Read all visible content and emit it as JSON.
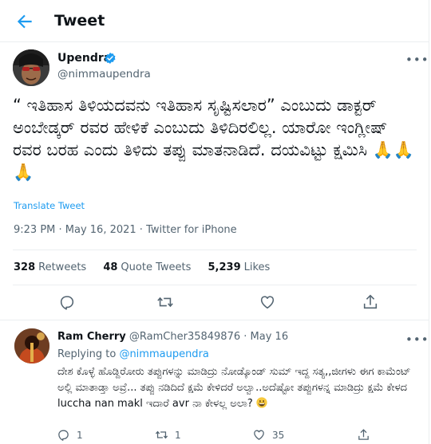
{
  "header": {
    "title": "Tweet"
  },
  "tweet": {
    "author_name": "Upendra",
    "author_handle": "@nimmaupendra",
    "text": "“ ಇತಿಹಾಸ ತಿಳಿಯದವನು ಇತಿಹಾಸ ಸೃಷ್ಟಿಸಲಾರ” ಎಂಬುದು ಡಾಕ್ಟರ್ ಅಂಬೇಡ್ಕರ್ ರವರ ಹೇಳಿಕೆ ಎಂಬುದು ತಿಳಿದಿರಲಿಲ್ಲ. ಯಾರೋ ಇಂಗ್ಲೀಷ್ ರವರ ಬರಹ ಎಂದು ತಿಳಿದು ತಪ್ಪು ಮಾತನಾಡಿದೆ. ದಯವಿಟ್ಟು ಕ್ಷಮಿಸಿ 🙏🙏🙏",
    "translate_label": "Translate Tweet",
    "timestamp": "9:23 PM · May 16, 2021 · Twitter for iPhone",
    "stats": {
      "retweets_count": "328",
      "retweets_label": "Retweets",
      "quotes_count": "48",
      "quotes_label": "Quote Tweets",
      "likes_count": "5,239",
      "likes_label": "Likes"
    }
  },
  "reply": {
    "name": "Ram Cherry",
    "handle": "@RamCher35849876",
    "dot": "·",
    "date": "May 16",
    "replying_prefix": "Replying to",
    "replying_to": "@nimmaupendra",
    "text": "ದೇಶ ಕೊಳ್ಳೆ ಹೊಡ್ದಿರೋರು ತಪ್ಪುಗಳನ್ನು ಮಾಡಿದ್ರು ನೋಡ್ಕೊಂಡ್ ಸುಮ್ ಇದ್ದ ಸತ್ಯ,,ಜೀಗಳು ಈಗ ಕಾಮೆಂಟ್ ಅಲ್ಲಿ ಮಾತಾಡ್ತಾ ಅವ್ರೆ... ತಪ್ಪು ನಡಿದಿದೆ ಕ್ಷಮೆ ಕೇಳಿದರೆ ಅಲ್ವಾ..ಅದೆಷ್ಟೋ ತಪ್ಪುಗಳನ್ನ ಮಾಡಿದ್ರು ಕ್ಷಮೆ ಕೇಳದ luccha nan makl ಇದಾರೆ avr ನಾ ಕೇಳಲ್ಲ ಅಲಾ?",
    "emoji_icon": "grinning-face-emoji",
    "reply_count": "1",
    "retweet_count": "1",
    "like_count": "35"
  },
  "colors": {
    "accent": "#1d9bf0",
    "muted": "#536471",
    "border": "#ebeef0"
  }
}
